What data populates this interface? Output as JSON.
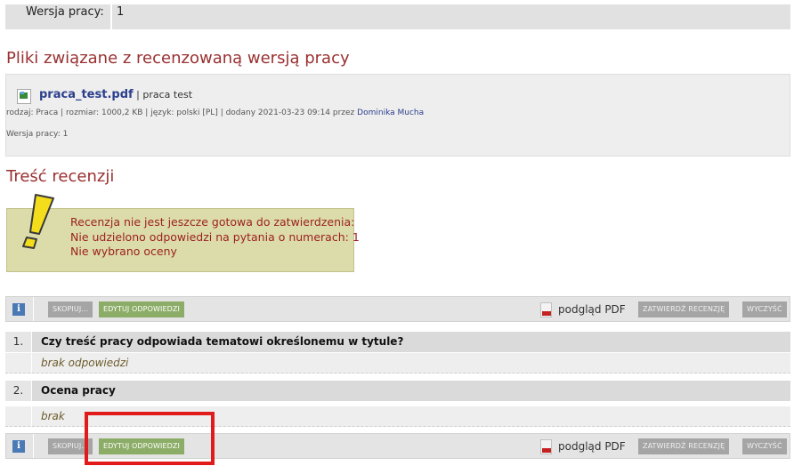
{
  "version_row": {
    "label": "Wersja pracy:",
    "value": "1"
  },
  "files_section": {
    "title": "Pliki związane z recenzowaną wersją pracy",
    "file": {
      "name": "praca_test.pdf",
      "separator": " | ",
      "description": "praca test",
      "meta_prefix": "rodzaj: Praca | rozmiar: 1000,2 KB | język: polski [PL] | dodany 2021-03-23 09:14 przez ",
      "author": "Dominika Mucha",
      "version": "Wersja pracy: 1"
    }
  },
  "review_section": {
    "title": "Treść recenzji"
  },
  "warning": {
    "icon": "exclamation-warning-icon",
    "lines": [
      "Recenzja nie jest jeszcze gotowa do zatwierdzenia:",
      "Nie udzielono odpowiedzi na pytania o numerach: 1",
      "Nie wybrano oceny"
    ]
  },
  "toolbar": {
    "info": "i",
    "copy_label": "SKOPIUJ...",
    "edit_label": "EDYTUJ ODPOWIEDZI",
    "pdf_preview": "podgląd PDF",
    "approve_label": "ZATWIERDŹ RECENZJĘ",
    "clear_label": "WYCZYŚĆ"
  },
  "questions": [
    {
      "number": "1.",
      "text": "Czy treść pracy odpowiada tematowi określonemu w tytule?",
      "answer": "brak odpowiedzi"
    },
    {
      "number": "2.",
      "text": "Ocena pracy",
      "answer": "brak"
    }
  ],
  "colors": {
    "accent_title": "#9a3030",
    "warning_text": "#9b2121",
    "green_button": "#8cad67",
    "highlight": "#e11b1b"
  }
}
